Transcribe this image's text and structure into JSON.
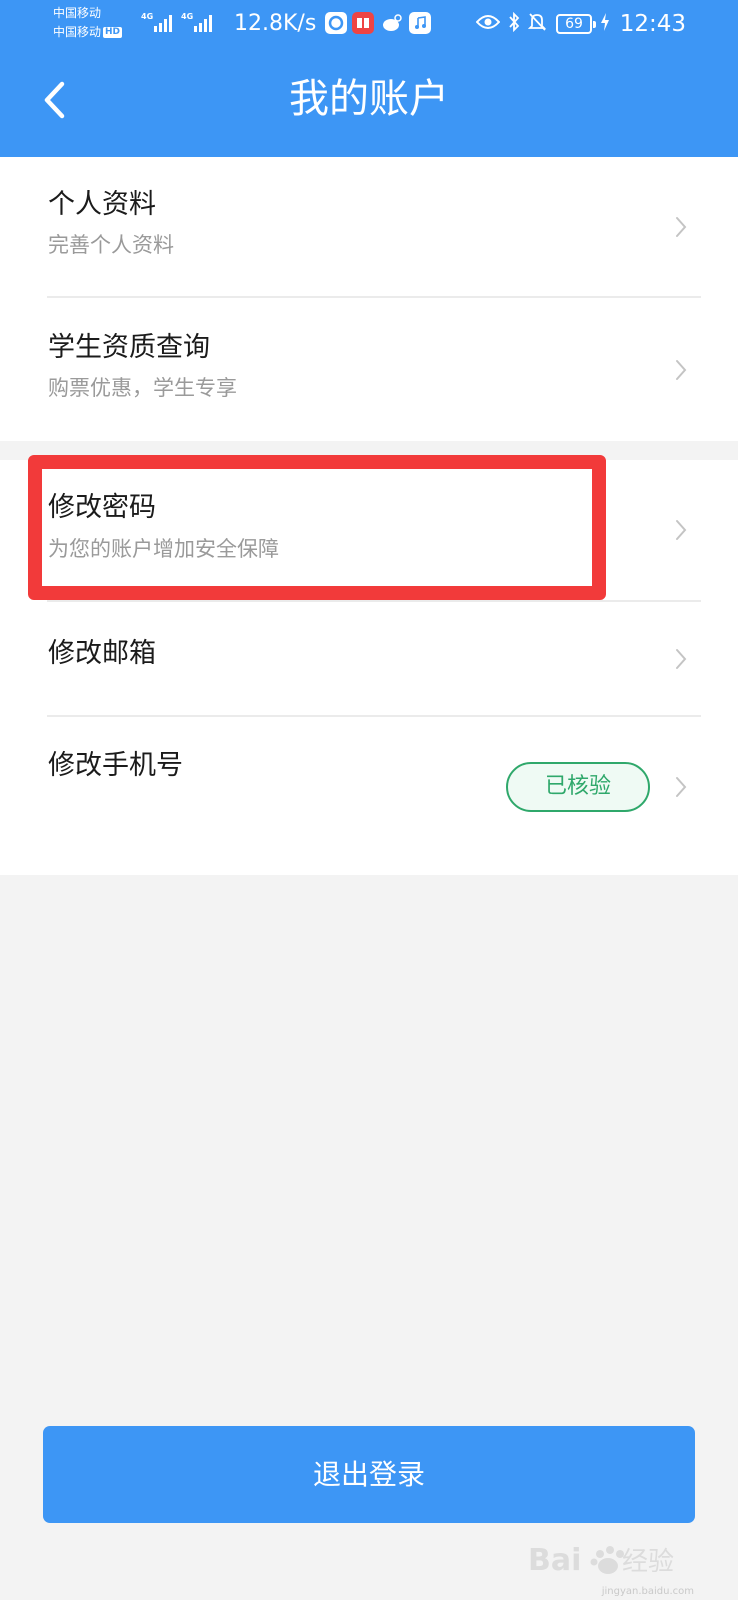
{
  "status_bar": {
    "carrier_1": "中国移动",
    "carrier_2": "中国移动",
    "hd_label": "HD",
    "net_type_1": "4G",
    "net_type_2": "4G",
    "speed": "12.8K/s",
    "battery": "69",
    "time": "12:43"
  },
  "nav": {
    "title": "我的账户",
    "back_icon": "chevron-left-icon"
  },
  "items": [
    {
      "title": "个人资料",
      "subtitle": "完善个人资料"
    },
    {
      "title": "学生资质查询",
      "subtitle": "购票优惠，学生专享"
    },
    {
      "title": "修改密码",
      "subtitle": "为您的账户增加安全保障"
    },
    {
      "title": "修改邮箱",
      "subtitle": ""
    },
    {
      "title": "修改手机号",
      "subtitle": "",
      "badge": "已核验"
    }
  ],
  "logout": {
    "label": "退出登录"
  },
  "watermark": {
    "brand": "Bai du 经验",
    "url": "jingyan.baidu.com"
  },
  "colors": {
    "primary": "#3d96f5",
    "highlight": "#f23a3a",
    "verified": "#2fa86b",
    "background": "#f3f3f3"
  }
}
